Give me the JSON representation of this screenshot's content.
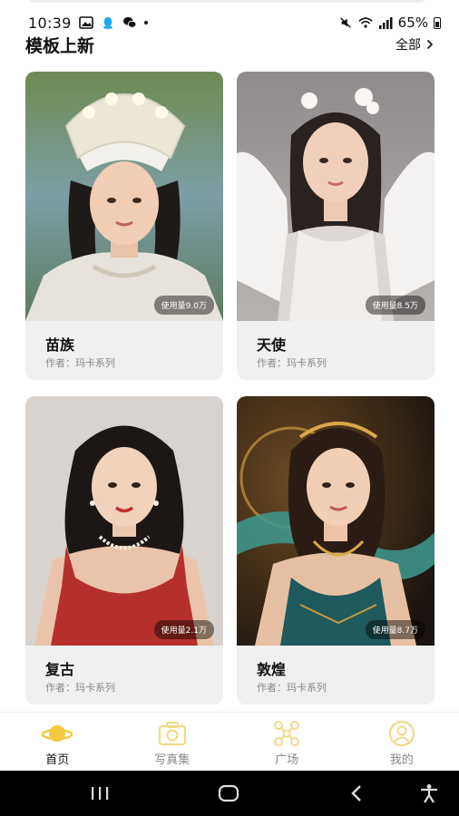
{
  "status_bar": {
    "time": "10:39",
    "battery_percent": "65%"
  },
  "section": {
    "title": "模板上新",
    "see_all": "全部"
  },
  "cards": [
    {
      "title": "苗族",
      "author": "作者：玛卡系列",
      "usage": "使用量9.0万"
    },
    {
      "title": "天使",
      "author": "作者：玛卡系列",
      "usage": "使用量8.5万"
    },
    {
      "title": "复古",
      "author": "作者：玛卡系列",
      "usage": "使用量2.1万"
    },
    {
      "title": "敦煌",
      "author": "作者：玛卡系列",
      "usage": "使用量8.7万"
    }
  ],
  "nav": [
    {
      "label": "首页",
      "icon": "planet-icon",
      "active": true
    },
    {
      "label": "写真集",
      "icon": "camera-icon",
      "active": false
    },
    {
      "label": "广场",
      "icon": "hub-icon",
      "active": false
    },
    {
      "label": "我的",
      "icon": "profile-icon",
      "active": false
    }
  ],
  "colors": {
    "accent": "#f5c842",
    "inactive_icon": "#f2d98a",
    "card_bg": "#f0f0f0",
    "muted_text": "#888888"
  }
}
